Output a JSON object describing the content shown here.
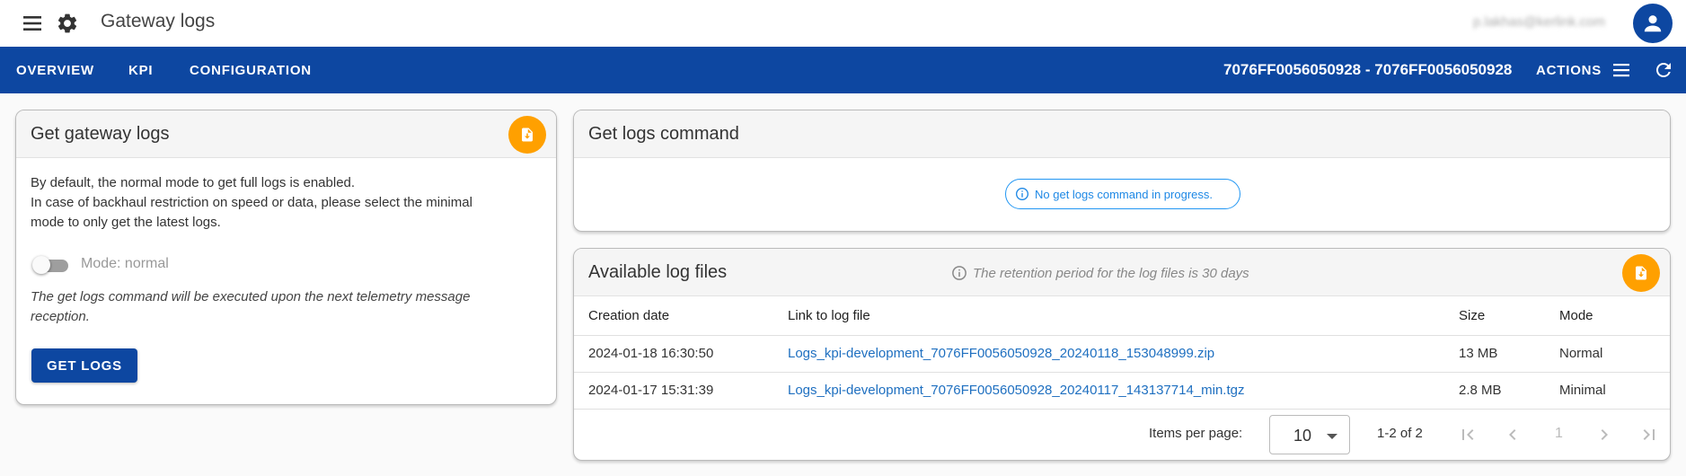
{
  "header": {
    "menu_icon": "menu-icon",
    "settings_icon": "gear-icon",
    "title": "Gateway logs",
    "user_email": "p.lakhas@kerlink.com",
    "avatar_icon": "person-icon"
  },
  "nav": {
    "tabs": [
      {
        "label": "OVERVIEW"
      },
      {
        "label": "KPI"
      },
      {
        "label": "CONFIGURATION"
      }
    ],
    "gateway_id": "7076FF0056050928 - 7076FF0056050928",
    "actions_label": "ACTIONS",
    "actions_icon": "menu-icon",
    "refresh_icon": "refresh-icon",
    "bar_color": "#0D47A1"
  },
  "get_logs_card": {
    "title": "Get gateway logs",
    "fab_icon": "file-download-icon",
    "description_line1": "By default, the normal mode to get full logs is enabled.",
    "description_line2": "In case of backhaul restriction on speed or data, please select the minimal",
    "description_line3": "mode to only get the latest logs.",
    "mode_label": "Mode: normal",
    "mode_enabled": false,
    "note_line1": "The get logs command will be executed upon the next telemetry message",
    "note_line2": "reception.",
    "button_label": "GET LOGS",
    "accent_color": "#FFA000"
  },
  "command_card": {
    "title": "Get logs command",
    "status_text": "No get logs command in progress.",
    "status_icon": "info-icon"
  },
  "files_card": {
    "title": "Available log files",
    "retention_text": "The retention period for the log files is 30 days",
    "retention_icon": "info-icon",
    "fab_icon": "file-download-icon",
    "columns": [
      "Creation date",
      "Link to log file",
      "Size",
      "Mode"
    ],
    "rows": [
      {
        "date": "2024-01-18 16:30:50",
        "link": "Logs_kpi-development_7076FF0056050928_20240118_153048999.zip",
        "size": "13 MB",
        "mode": "Normal"
      },
      {
        "date": "2024-01-17 15:31:39",
        "link": "Logs_kpi-development_7076FF0056050928_20240117_143137714_min.tgz",
        "size": "2.8 MB",
        "mode": "Minimal"
      }
    ],
    "pagination": {
      "items_per_page_label": "Items per page:",
      "items_per_page": "10",
      "range": "1-2 of 2",
      "page": "1",
      "first_icon": "first-page-icon",
      "prev_icon": "chevron-left-icon",
      "next_icon": "chevron-right-icon",
      "last_icon": "last-page-icon"
    }
  }
}
